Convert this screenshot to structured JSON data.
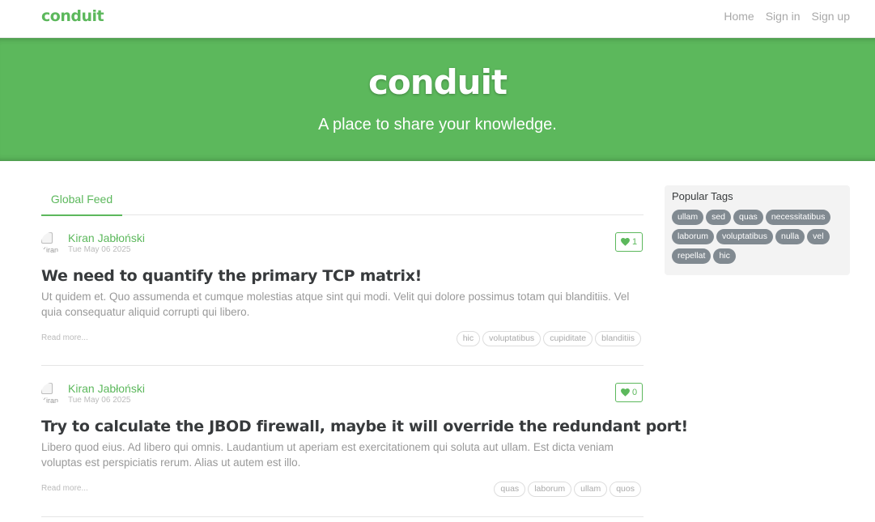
{
  "nav": {
    "brand": "conduit",
    "links": [
      "Home",
      "Sign in",
      "Sign up"
    ]
  },
  "banner": {
    "title": "conduit",
    "subtitle": "A place to share your knowledge."
  },
  "feed": {
    "tab_label": "Global Feed"
  },
  "articles": [
    {
      "avatar_alt": "Kiran",
      "author": "Kiran Jabłoński",
      "date": "Tue May 06 2025",
      "favorites": "1",
      "title": "We need to quantify the primary TCP matrix!",
      "description": "Ut quidem et. Quo assumenda et cumque molestias atque sint qui modi. Velit qui dolore possimus totam qui blanditiis. Vel quia consequatur aliquid corrupti qui libero.",
      "read_more": "Read more...",
      "tags": [
        "hic",
        "voluptatibus",
        "cupiditate",
        "blanditiis"
      ]
    },
    {
      "avatar_alt": "Kiran",
      "author": "Kiran Jabłoński",
      "date": "Tue May 06 2025",
      "favorites": "0",
      "title": "Try to calculate the JBOD firewall, maybe it will override the redundant port!",
      "description": "Libero quod eius. Ad libero qui omnis. Laudantium ut aperiam est exercitationem qui soluta aut ullam. Est dicta veniam voluptas est perspiciatis rerum. Alias ut autem est illo.",
      "read_more": "Read more...",
      "tags": [
        "quas",
        "laborum",
        "ullam",
        "quos"
      ]
    }
  ],
  "sidebar": {
    "title": "Popular Tags",
    "tags": [
      "ullam",
      "sed",
      "quas",
      "necessitatibus",
      "laborum",
      "voluptatibus",
      "nulla",
      "vel",
      "repellat",
      "hic"
    ]
  },
  "colors": {
    "brand_green": "#5cb85c",
    "tag_gray": "#818a91"
  }
}
